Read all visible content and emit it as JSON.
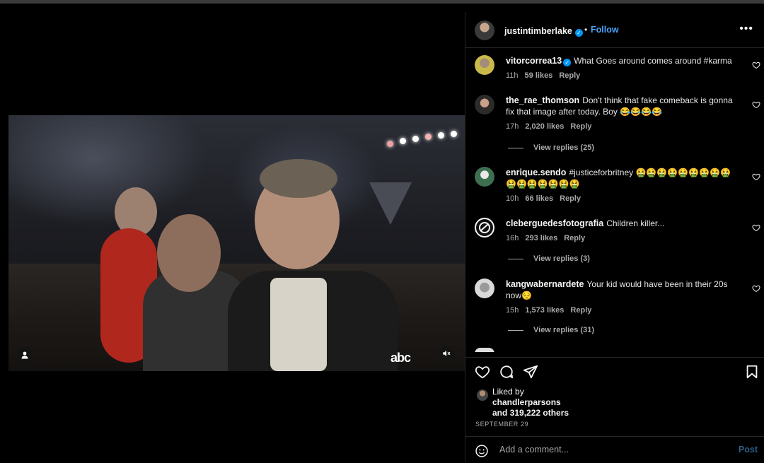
{
  "header": {
    "username": "justintimberlake",
    "separator": "•",
    "follow_label": "Follow",
    "more_label": "•••"
  },
  "video": {
    "watermark": "abc"
  },
  "comments": [
    {
      "username": "vitorcorrea13",
      "verified": true,
      "text": "What Goes around comes around #karma",
      "time": "11h",
      "likes": "59 likes",
      "reply": "Reply",
      "view_replies": ""
    },
    {
      "username": "the_rae_thomson",
      "verified": false,
      "text": "Don't think that fake comeback is gonna fix that image after today. Boy 😂😂😂😂",
      "time": "17h",
      "likes": "2,020 likes",
      "reply": "Reply",
      "view_replies": "View replies (25)"
    },
    {
      "username": "enrique.sendo",
      "verified": false,
      "text": "#justiceforbritney 🤮🤮🤮🤮🤮🤮🤮🤮🤮🤮🤮🤮🤮🤮🤮🤮",
      "time": "10h",
      "likes": "66 likes",
      "reply": "Reply",
      "view_replies": ""
    },
    {
      "username": "cleberguedesfotografia",
      "verified": false,
      "text": "Children killer...",
      "time": "16h",
      "likes": "293 likes",
      "reply": "Reply",
      "view_replies": "View replies (3)"
    },
    {
      "username": "kangwabernardete",
      "verified": false,
      "text": "Your kid would have been in their 20s now😔",
      "time": "15h",
      "likes": "1,573 likes",
      "reply": "Reply",
      "view_replies": "View replies (31)"
    }
  ],
  "likes": {
    "liked_by_label": "Liked by",
    "liked_by_user": "chandlerparsons",
    "others": "and 319,222 others"
  },
  "date": "SEPTEMBER 29",
  "comment_box": {
    "placeholder": "Add a comment...",
    "post_label": "Post"
  },
  "colors": {
    "follow": "#4aa3f7",
    "verified": "#0095f6",
    "muted_text": "#a8a8a8",
    "post_disabled": "#2f5f86"
  }
}
